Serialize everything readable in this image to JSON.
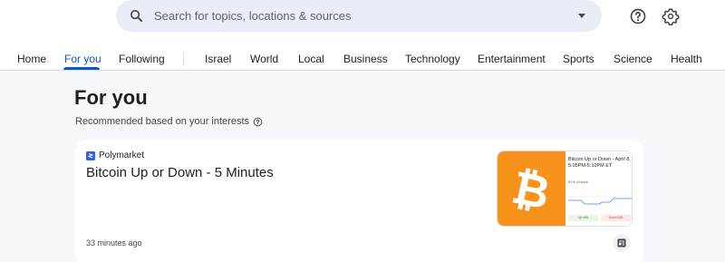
{
  "search": {
    "placeholder": "Search for topics, locations & sources",
    "icon": "search-icon"
  },
  "header": {
    "help_icon": "help-icon",
    "settings_icon": "gear-icon"
  },
  "tabs": [
    {
      "label": "Home"
    },
    {
      "label": "For you",
      "active": true
    },
    {
      "label": "Following"
    },
    {
      "label": "Israel"
    },
    {
      "label": "World"
    },
    {
      "label": "Local"
    },
    {
      "label": "Business"
    },
    {
      "label": "Technology"
    },
    {
      "label": "Entertainment"
    },
    {
      "label": "Sports"
    },
    {
      "label": "Science"
    },
    {
      "label": "Health"
    }
  ],
  "page": {
    "title": "For you",
    "subtitle": "Recommended based on your interests"
  },
  "card": {
    "source": "Polymarket",
    "headline": "Bitcoin Up or Down - 5 Minutes",
    "timestamp": "33 minutes ago",
    "thumbnail": {
      "title": "Bitcoin Up or Down - April 8, 5:05PM-5:10PM ET",
      "chance": "51% chance",
      "up": "Up 49¢",
      "down": "Down 52¢"
    }
  },
  "colors": {
    "accent": "#0b57d0",
    "background": "#f6f8fc",
    "bitcoin": "#f7931a"
  }
}
